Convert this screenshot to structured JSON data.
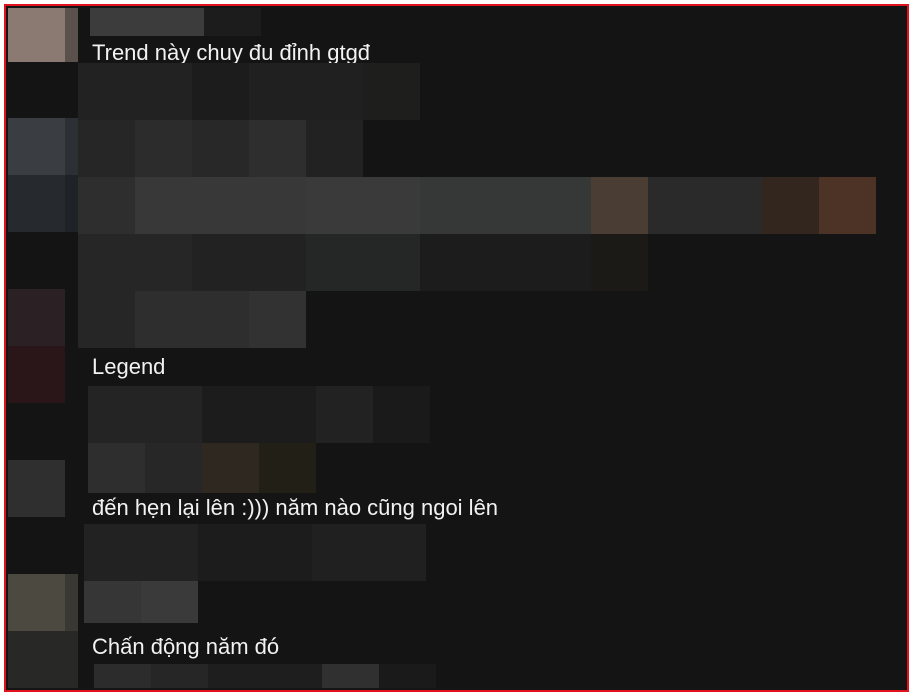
{
  "comments": [
    {
      "text": "Trend này chuy đu đỉnh gtgđ"
    },
    {
      "text": "Legend"
    },
    {
      "text": "đến hẹn lại lên :))) năm nào cũng ngoi lên"
    },
    {
      "text": "Chấn động năm đó"
    }
  ],
  "colors": {
    "frame_border": "#e0121b",
    "background": "#141414",
    "text": "#f2f2f2"
  }
}
